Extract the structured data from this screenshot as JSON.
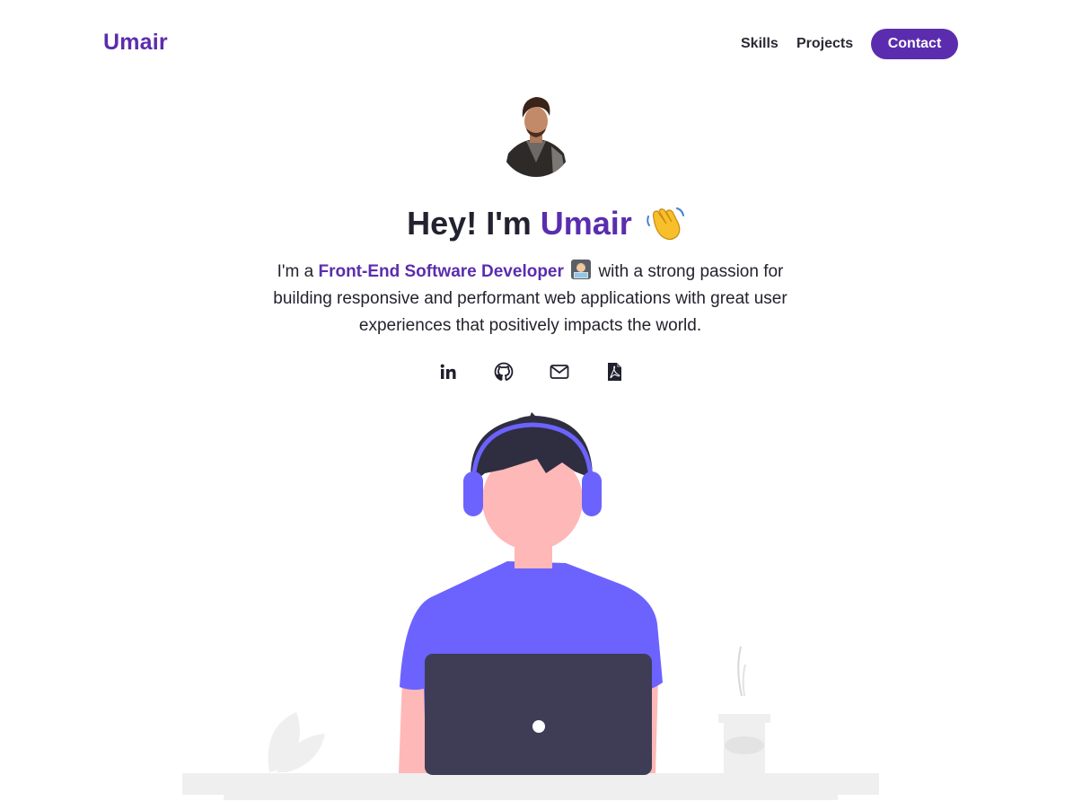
{
  "nav": {
    "logo": "Umair",
    "links": [
      "Skills",
      "Projects"
    ],
    "contact_label": "Contact"
  },
  "hero": {
    "title_prefix": "Hey! I'm ",
    "title_name": "Umair",
    "title_emoji": "waving-hand",
    "desc_prefix": "I'm a ",
    "desc_role": "Front-End Software Developer",
    "desc_emoji": "technologist",
    "desc_suffix": " with a strong passion for building responsive and performant web applications with great user experiences that positively impacts the world."
  },
  "socials": [
    "linkedin-icon",
    "github-icon",
    "email-icon",
    "pdf-resume-icon"
  ],
  "colors": {
    "accent": "#5b2dae",
    "illustration_purple": "#6c63ff",
    "illustration_dark": "#3f3d56",
    "skin": "#ffb8b8"
  }
}
